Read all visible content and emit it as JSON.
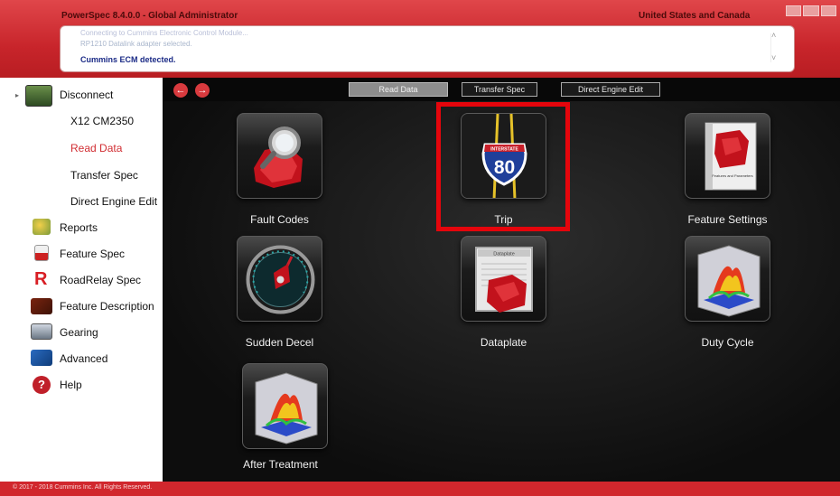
{
  "window": {
    "title": "PowerSpec 8.4.0.0 - Global Administrator",
    "region": "United States and Canada"
  },
  "messages": {
    "line1": "Connecting to Cummins Electronic Control Module...",
    "line2": "RP1210 Datalink adapter selected.",
    "line3": "Cummins ECM detected."
  },
  "sidebar": {
    "disconnect": "Disconnect",
    "sub_items": [
      {
        "label": "X12 CM2350"
      },
      {
        "label": "Read Data"
      },
      {
        "label": "Transfer Spec"
      },
      {
        "label": "Direct Engine Edit"
      }
    ],
    "items": [
      {
        "label": "Reports",
        "icon": "reports-icon"
      },
      {
        "label": "Feature Spec",
        "icon": "feature-spec-icon"
      },
      {
        "label": "RoadRelay Spec",
        "icon": "roadrelay-icon"
      },
      {
        "label": "Feature Description",
        "icon": "book-icon"
      },
      {
        "label": "Gearing",
        "icon": "gearing-icon"
      },
      {
        "label": "Advanced",
        "icon": "advanced-icon"
      },
      {
        "label": "Help",
        "icon": "help-icon"
      }
    ]
  },
  "toolbar": {
    "read_data": "Read Data",
    "transfer_spec": "Transfer Spec",
    "direct_engine_edit": "Direct Engine Edit"
  },
  "tiles": {
    "fault_codes": "Fault Codes",
    "trip": "Trip",
    "feature_settings": "Feature Settings",
    "sudden_decel": "Sudden Decel",
    "dataplate": "Dataplate",
    "duty_cycle": "Duty Cycle",
    "after_treatment": "After Treatment",
    "interstate_number": "80",
    "interstate_text": "INTERSTATE",
    "dataplate_header": "Dataplate",
    "feature_book_text": "Features and Parameters"
  },
  "footer": {
    "copyright": "© 2017 - 2018 Cummins Inc. All Rights Reserved."
  },
  "colors": {
    "brand_red": "#d1272d",
    "highlight": "#e5050c",
    "active_nav": "#d12e33"
  }
}
